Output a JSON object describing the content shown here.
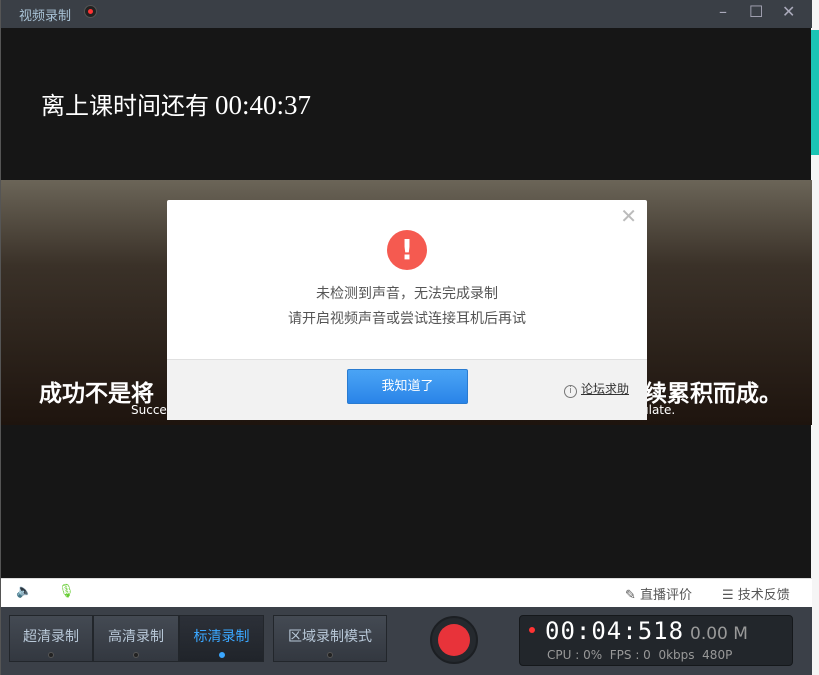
{
  "window": {
    "title": "视频录制",
    "minimize": "–",
    "maximize": "☐",
    "close": "✕"
  },
  "countdown": {
    "label": "离上课时间还有",
    "time": "00:40:37"
  },
  "banner": {
    "slogan_left": "成功不是将",
    "slogan_right": "续累积而成。",
    "sub_left": "Succe",
    "sub_right": "ulate."
  },
  "dialog": {
    "icon": "exclamation-icon",
    "line1": "未检测到声音，无法完成录制",
    "line2": "请开启视频声音或尝试连接耳机后再试",
    "ok": "我知道了",
    "help": "论坛求助",
    "close": "✕",
    "accent": "#2a84e8",
    "warn_color": "#f55a50"
  },
  "toolbar": {
    "speaker": "🔈",
    "mic": "🎙",
    "rate": "直播评价",
    "feedback": "技术反馈"
  },
  "modes": [
    {
      "label": "超清录制"
    },
    {
      "label": "高清录制"
    },
    {
      "label": "标清录制",
      "active": true
    },
    {
      "label": "区域录制模式"
    }
  ],
  "stats": {
    "time": "00:04:518",
    "size": "0.00 M",
    "cpu": "CPU : 0%",
    "fps": "FPS : 0",
    "kbps": "0kbps",
    "res": "480P"
  }
}
